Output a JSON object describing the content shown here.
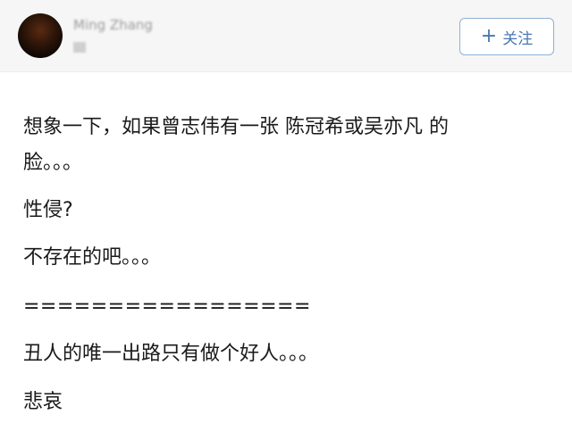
{
  "header": {
    "user_name": "Ming Zhang",
    "follow_label": "关注",
    "follow_icon": "plus-icon"
  },
  "post": {
    "lines": [
      "想象一下，如果曾志伟有一张 陈冠希或吴亦凡 的",
      "脸。。。",
      "性侵?",
      "不存在的吧。。。",
      "=================",
      "丑人的唯一出路只有做个好人。。。",
      "悲哀"
    ]
  }
}
